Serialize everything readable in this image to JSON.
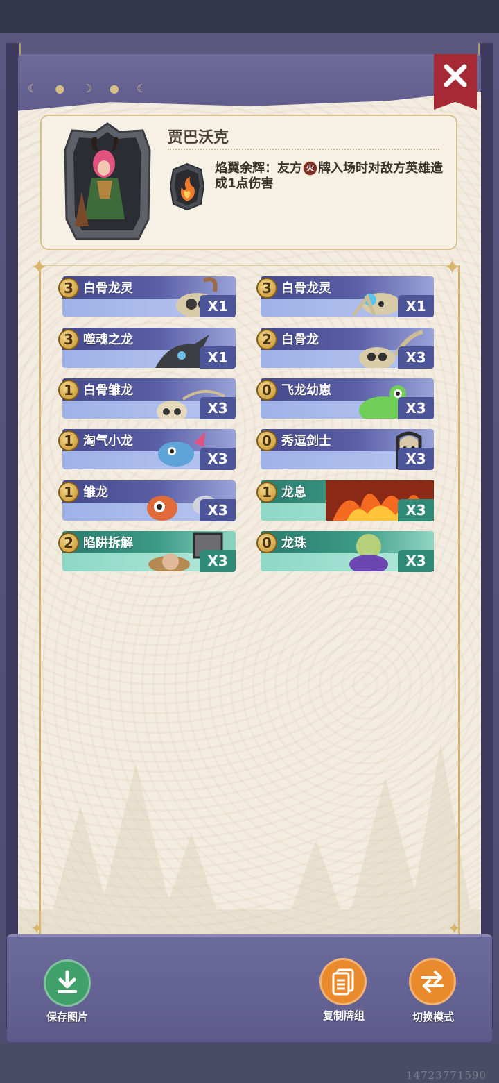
{
  "hero": {
    "name": "贾巴沃克",
    "skill_text_before": "焰翼余辉：友方",
    "skill_badge": "火",
    "skill_text_after": "牌入场时对敌方英雄造成1点伤害"
  },
  "cards": [
    {
      "cost": "3",
      "name": "白骨龙灵",
      "count": "X1",
      "style": "blue"
    },
    {
      "cost": "3",
      "name": "白骨龙灵",
      "count": "X1",
      "style": "blue"
    },
    {
      "cost": "3",
      "name": "噬魂之龙",
      "count": "X1",
      "style": "blue"
    },
    {
      "cost": "2",
      "name": "白骨龙",
      "count": "X3",
      "style": "blue"
    },
    {
      "cost": "1",
      "name": "白骨雏龙",
      "count": "X3",
      "style": "blue"
    },
    {
      "cost": "0",
      "name": "飞龙幼崽",
      "count": "X3",
      "style": "blue"
    },
    {
      "cost": "1",
      "name": "淘气小龙",
      "count": "X3",
      "style": "blue"
    },
    {
      "cost": "0",
      "name": "秀逗剑士",
      "count": "X3",
      "style": "blue"
    },
    {
      "cost": "1",
      "name": "雏龙",
      "count": "X3",
      "style": "blue"
    },
    {
      "cost": "1",
      "name": "龙息",
      "count": "X3",
      "style": "green"
    },
    {
      "cost": "2",
      "name": "陷阱拆解",
      "count": "X3",
      "style": "green"
    },
    {
      "cost": "0",
      "name": "龙珠",
      "count": "X3",
      "style": "green"
    }
  ],
  "buttons": {
    "save": "保存图片",
    "copy": "复制牌组",
    "switch": "切换模式"
  },
  "watermark": "14723771590"
}
